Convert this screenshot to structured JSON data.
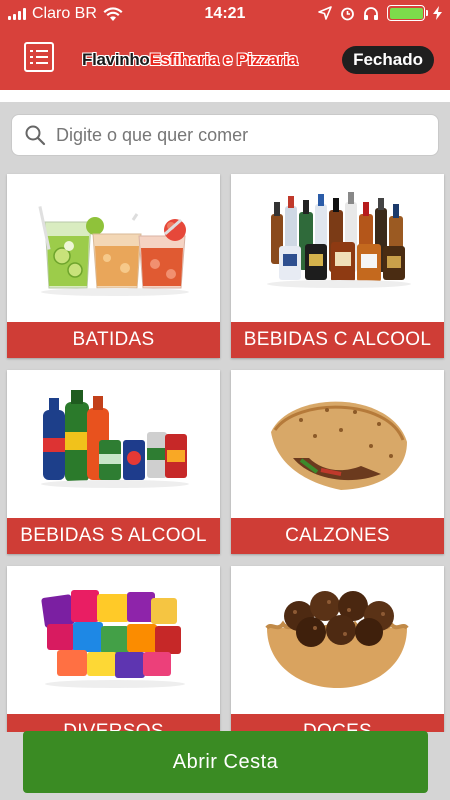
{
  "status_bar": {
    "carrier": "Claro BR",
    "time": "14:21"
  },
  "header": {
    "title_part1": "Flavinho",
    "title_part2": "Esfiharia e Pizzaria",
    "status": "Fechado",
    "menu_icon": "list-menu-icon"
  },
  "search": {
    "placeholder": "Digite o que quer comer",
    "icon": "search-icon"
  },
  "categories": [
    {
      "label": "BATIDAS"
    },
    {
      "label": "BEBIDAS C ALCOOL"
    },
    {
      "label": "BEBIDAS S ALCOOL"
    },
    {
      "label": "CALZONES"
    },
    {
      "label": "DIVERSOS"
    },
    {
      "label": "DOCES"
    }
  ],
  "footer": {
    "cart_button": "Abrir Cesta"
  },
  "colors": {
    "header": "#d8413b",
    "label_bar": "#cf3d36",
    "cta": "#3a8b23"
  }
}
